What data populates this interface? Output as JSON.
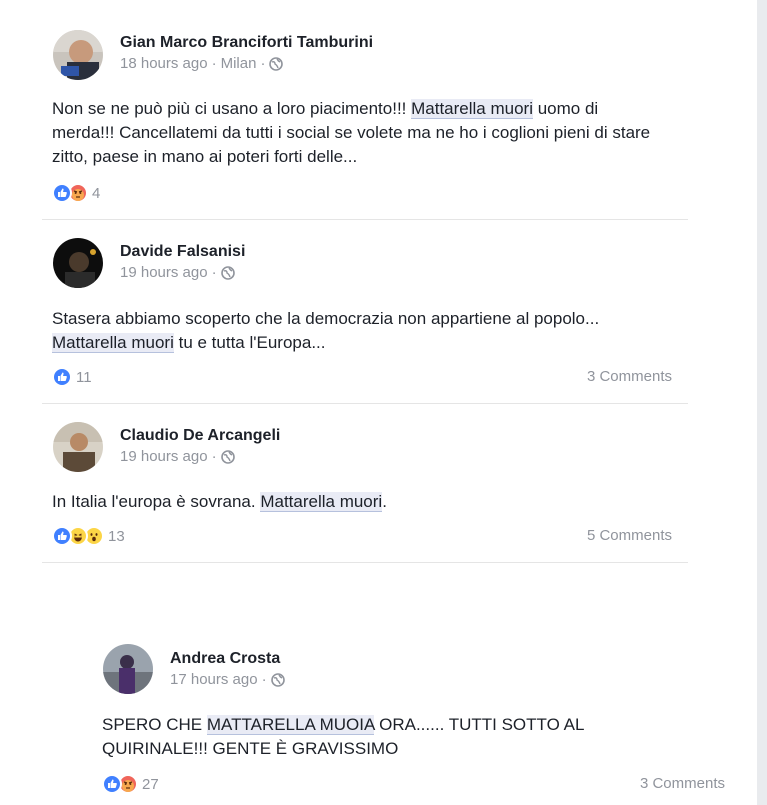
{
  "posts": [
    {
      "author": "Gian Marco Branciforti Tamburini",
      "time": "18 hours ago",
      "location": "Milan",
      "text_before": "Non se ne può più ci usano a loro piacimento!!! ",
      "highlight": "Mattarella muori",
      "text_after": " uomo di merda!!! Cancellatemi da tutti i social se volete ma ne ho i coglioni pieni di stare zitto, paese in mano ai poteri forti delle...",
      "reaction_icons": [
        "like-icon",
        "angry-icon"
      ],
      "reaction_count": "4",
      "comments": ""
    },
    {
      "author": "Davide Falsanisi",
      "time": "19 hours ago",
      "text_before": "Stasera abbiamo scoperto che la democrazia non appartiene al popolo... ",
      "highlight": "Mattarella muori",
      "text_after": " tu e tutta l'Europa...",
      "reaction_icons": [
        "like-icon"
      ],
      "reaction_count": "11",
      "comments": "3 Comments"
    },
    {
      "author": "Claudio De Arcangeli",
      "time": "19 hours ago",
      "text_before": "In Italia l'europa è sovrana. ",
      "highlight": "Mattarella muori",
      "text_after": ".",
      "reaction_icons": [
        "like-icon",
        "haha-icon",
        "wow-icon"
      ],
      "reaction_count": "13",
      "comments": "5 Comments"
    },
    {
      "author": "Andrea Crosta",
      "time": "17 hours ago",
      "text_before": "SPERO CHE ",
      "highlight": "MATTARELLA MUOIA",
      "text_after": " ORA...... TUTTI SOTTO AL QUIRINALE!!! GENTE È GRAVISSIMO",
      "reaction_icons": [
        "like-icon",
        "angry-icon"
      ],
      "reaction_count": "27",
      "comments": "3 Comments"
    }
  ],
  "separator": "·",
  "colors": {
    "like": "#4080ff",
    "angry": "#f0655a",
    "haha": "#fcd546",
    "highlight_bg": "#e9ebf5",
    "meta": "#90949c"
  }
}
